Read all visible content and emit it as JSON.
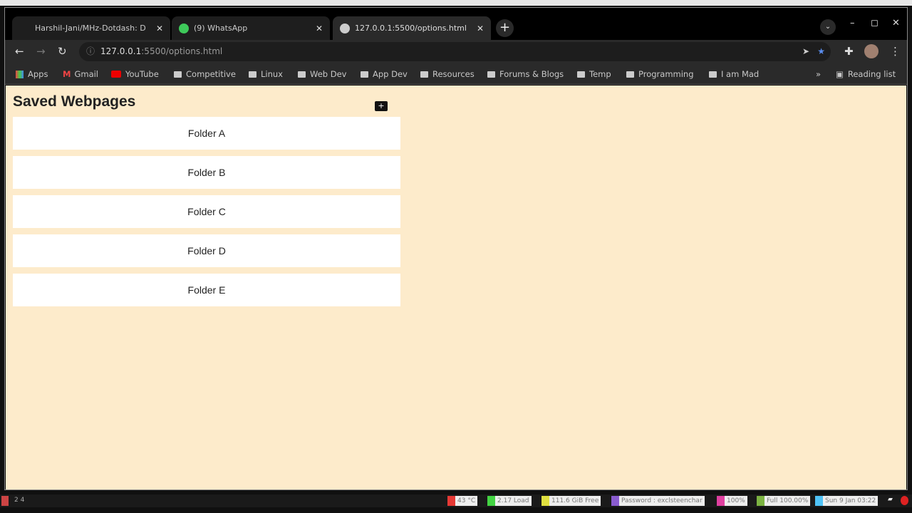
{
  "browser": {
    "tabs": [
      {
        "title": "Harshil-Jani/MHz-Dotdash: D",
        "active": false
      },
      {
        "title": "(9) WhatsApp",
        "active": false
      },
      {
        "title": "127.0.0.1:5500/options.html",
        "active": true
      }
    ],
    "url_host": "127.0.0.1",
    "url_rest": ":5500/options.html",
    "bookmarks": [
      "Apps",
      "Gmail",
      "YouTube",
      "Competitive",
      "Linux",
      "Web Dev",
      "App Dev",
      "Resources",
      "Forums & Blogs",
      "Temp",
      "Programming",
      "I am Mad"
    ],
    "reading_list": "Reading list"
  },
  "page": {
    "title": "Saved Webpages",
    "folders": [
      "Folder A",
      "Folder B",
      "Folder C",
      "Folder D",
      "Folder E"
    ]
  },
  "statusbar": {
    "workspaces": "2  4",
    "items": [
      {
        "text": "43 °C",
        "color": "#e53935"
      },
      {
        "text": "2.17 Load",
        "color": "#43d343"
      },
      {
        "text": "111.6 GiB Free",
        "color": "#e0e040"
      },
      {
        "text": "Password : exclsteenchar",
        "color": "#8a5cd0"
      },
      {
        "text": "100%",
        "color": "#e040a0"
      },
      {
        "text": "Full 100.00%",
        "color": "#7cb342"
      },
      {
        "text": "Sun 9 Jan 03:22",
        "color": "#4fc3f7"
      }
    ]
  }
}
